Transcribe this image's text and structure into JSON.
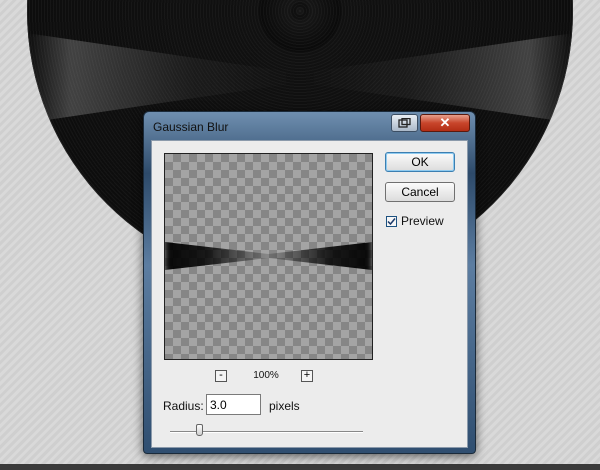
{
  "dialog": {
    "title": "Gaussian Blur",
    "close_glyph": "✕",
    "restore_icon": "restore-icon"
  },
  "buttons": {
    "ok_label": "OK",
    "cancel_label": "Cancel"
  },
  "preview": {
    "checkbox_label": "Preview",
    "checked": true,
    "zoom_minus": "-",
    "zoom_plus": "+",
    "zoom_value": "100%"
  },
  "radius": {
    "label": "Radius:",
    "value": "3.0",
    "units": "pixels",
    "slider_position": 0.14
  },
  "colors": {
    "ok_focus": "#3c7fb1",
    "close_button": "#c8452b"
  }
}
